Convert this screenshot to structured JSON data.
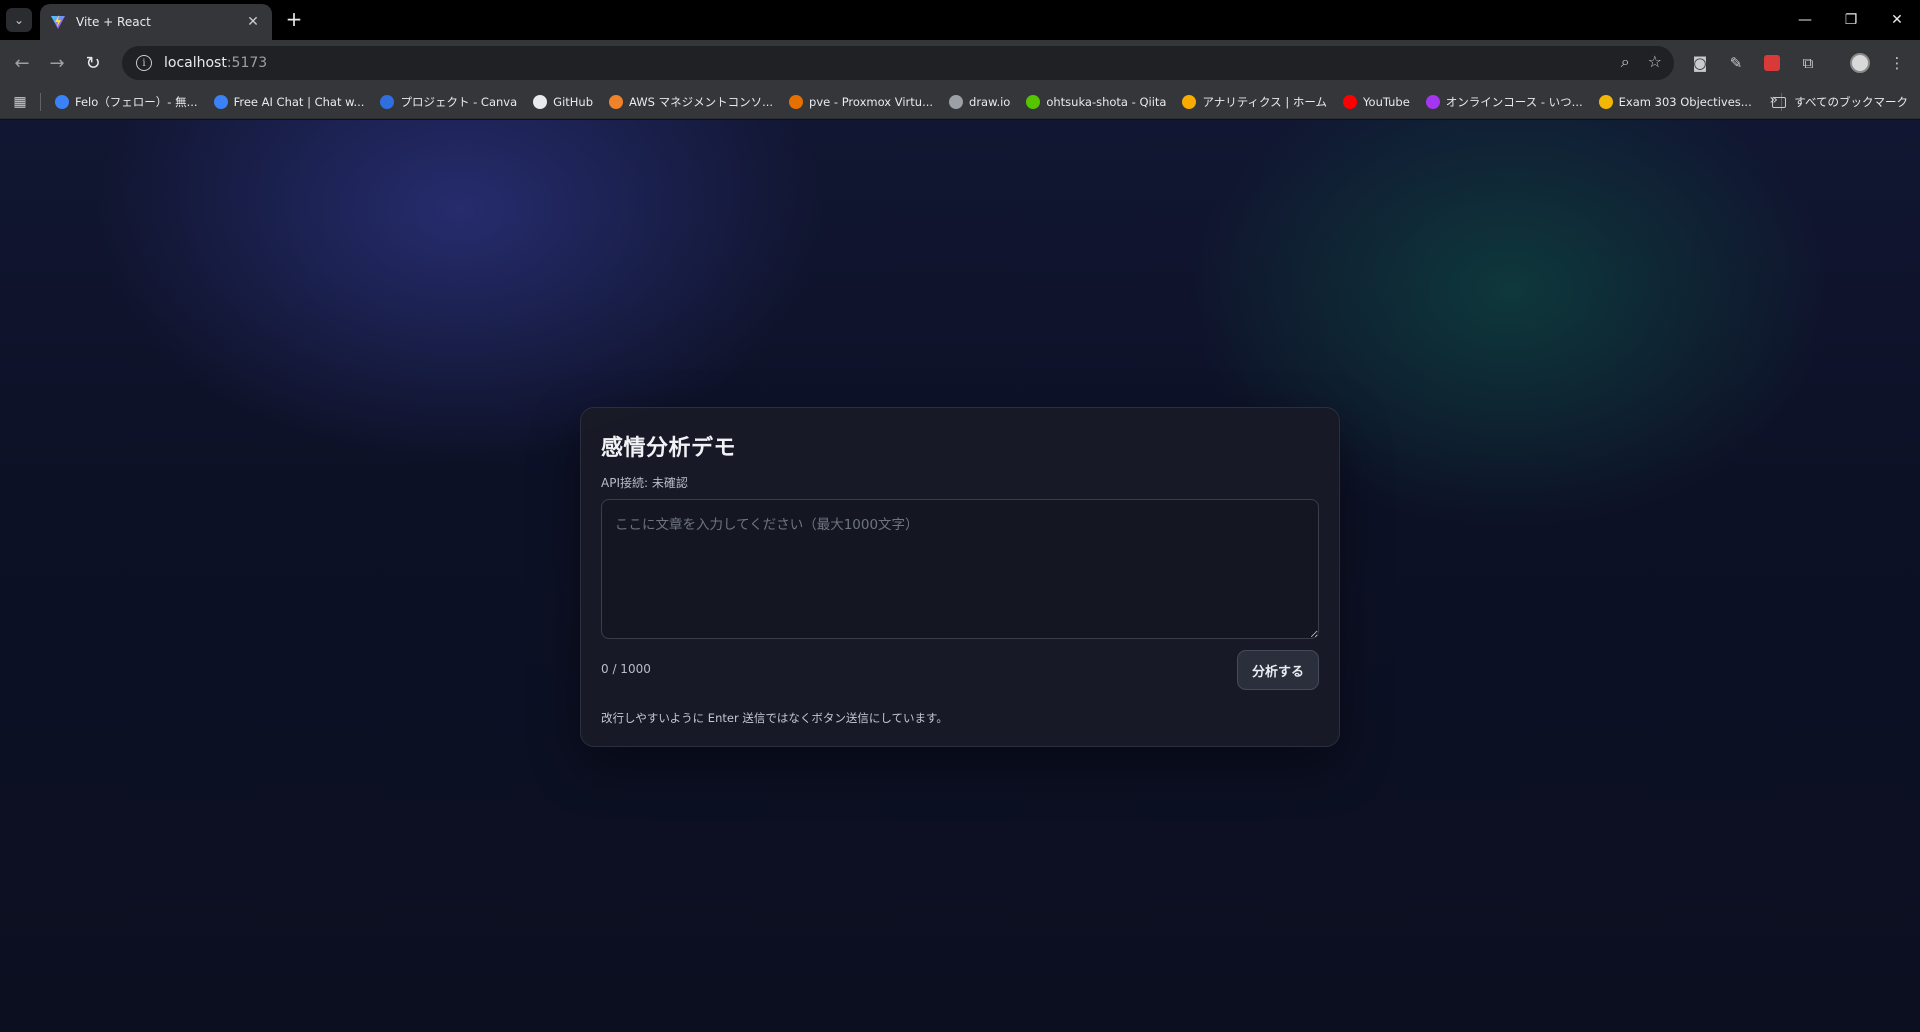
{
  "browser": {
    "tab_title": "Vite + React",
    "url_host": "localhost",
    "url_port": ":5173",
    "bookmarks": [
      {
        "label": "Felo（フェロー）- 無...",
        "icon": "felo-icon",
        "color": "#3b82f6"
      },
      {
        "label": "Free AI Chat | Chat w...",
        "icon": "chat-icon",
        "color": "#3b82f6"
      },
      {
        "label": "プロジェクト - Canva",
        "icon": "canva-icon",
        "color": "#2f6fe0"
      },
      {
        "label": "GitHub",
        "icon": "github-icon",
        "color": "#e8eaed"
      },
      {
        "label": "AWS マネジメントコンソ...",
        "icon": "aws-icon",
        "color": "#f0822a"
      },
      {
        "label": "pve - Proxmox Virtu...",
        "icon": "proxmox-icon",
        "color": "#e57000"
      },
      {
        "label": "draw.io",
        "icon": "drawio-icon",
        "color": "#9aa0a6"
      },
      {
        "label": "ohtsuka-shota - Qiita",
        "icon": "qiita-icon",
        "color": "#55c500"
      },
      {
        "label": "アナリティクス | ホーム",
        "icon": "analytics-icon",
        "color": "#f9ab00"
      },
      {
        "label": "YouTube",
        "icon": "youtube-icon",
        "color": "#ff0000"
      },
      {
        "label": "オンラインコース - いつ...",
        "icon": "udemy-icon",
        "color": "#a435f0"
      },
      {
        "label": "Exam 303 Objectives...",
        "icon": "exam-icon",
        "color": "#f2b705"
      }
    ],
    "all_bookmarks_label": "すべてのブックマーク"
  },
  "app": {
    "title": "感情分析デモ",
    "api_status": "API接続: 未確認",
    "textarea_placeholder": "ここに文章を入力してください（最大1000文字）",
    "textarea_value": "",
    "char_counter": "0 / 1000",
    "analyze_button": "分析する",
    "hint": "改行しやすいように Enter 送信ではなくボタン送信にしています。"
  }
}
